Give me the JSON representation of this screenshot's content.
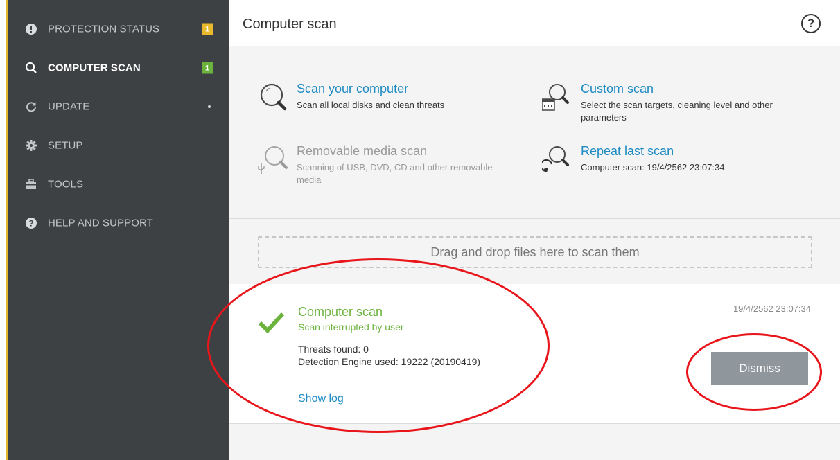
{
  "sidebar": {
    "items": [
      {
        "label": "PROTECTION STATUS",
        "icon": "exclamation-circle-icon",
        "badge": "1",
        "badge_color": "#e8b92a"
      },
      {
        "label": "COMPUTER SCAN",
        "icon": "search-icon",
        "badge": "1",
        "badge_color": "#6cb33e",
        "active": true
      },
      {
        "label": "UPDATE",
        "icon": "refresh-icon"
      },
      {
        "label": "SETUP",
        "icon": "gear-icon"
      },
      {
        "label": "TOOLS",
        "icon": "toolbox-icon"
      },
      {
        "label": "HELP AND SUPPORT",
        "icon": "help-circle-icon"
      }
    ]
  },
  "header": {
    "title": "Computer scan",
    "help_glyph": "?"
  },
  "scan_options": [
    {
      "title": "Scan your computer",
      "desc": "Scan all local disks and clean threats",
      "icon": "magnifier-icon"
    },
    {
      "title": "Custom scan",
      "desc": "Select the scan targets, cleaning level and other parameters",
      "icon": "custom-scan-icon"
    },
    {
      "title": "Removable media scan",
      "desc": "Scanning of USB, DVD, CD and other removable media",
      "icon": "usb-scan-icon",
      "disabled": true
    },
    {
      "title": "Repeat last scan",
      "desc": "Computer scan: 19/4/2562 23:07:34",
      "icon": "repeat-scan-icon"
    }
  ],
  "dropzone": {
    "text": "Drag and drop files here to scan them"
  },
  "result": {
    "title": "Computer scan",
    "status": "Scan interrupted by user",
    "threats": "Threats found: 0",
    "engine": "Detection Engine used: 19222 (20190419)",
    "show_log": "Show log",
    "timestamp": "19/4/2562 23:07:34",
    "dismiss": "Dismiss"
  },
  "colors": {
    "accent": "#e4b62c",
    "link": "#1e8bc3",
    "success": "#6cb33e",
    "annotation": "#e8161b"
  }
}
